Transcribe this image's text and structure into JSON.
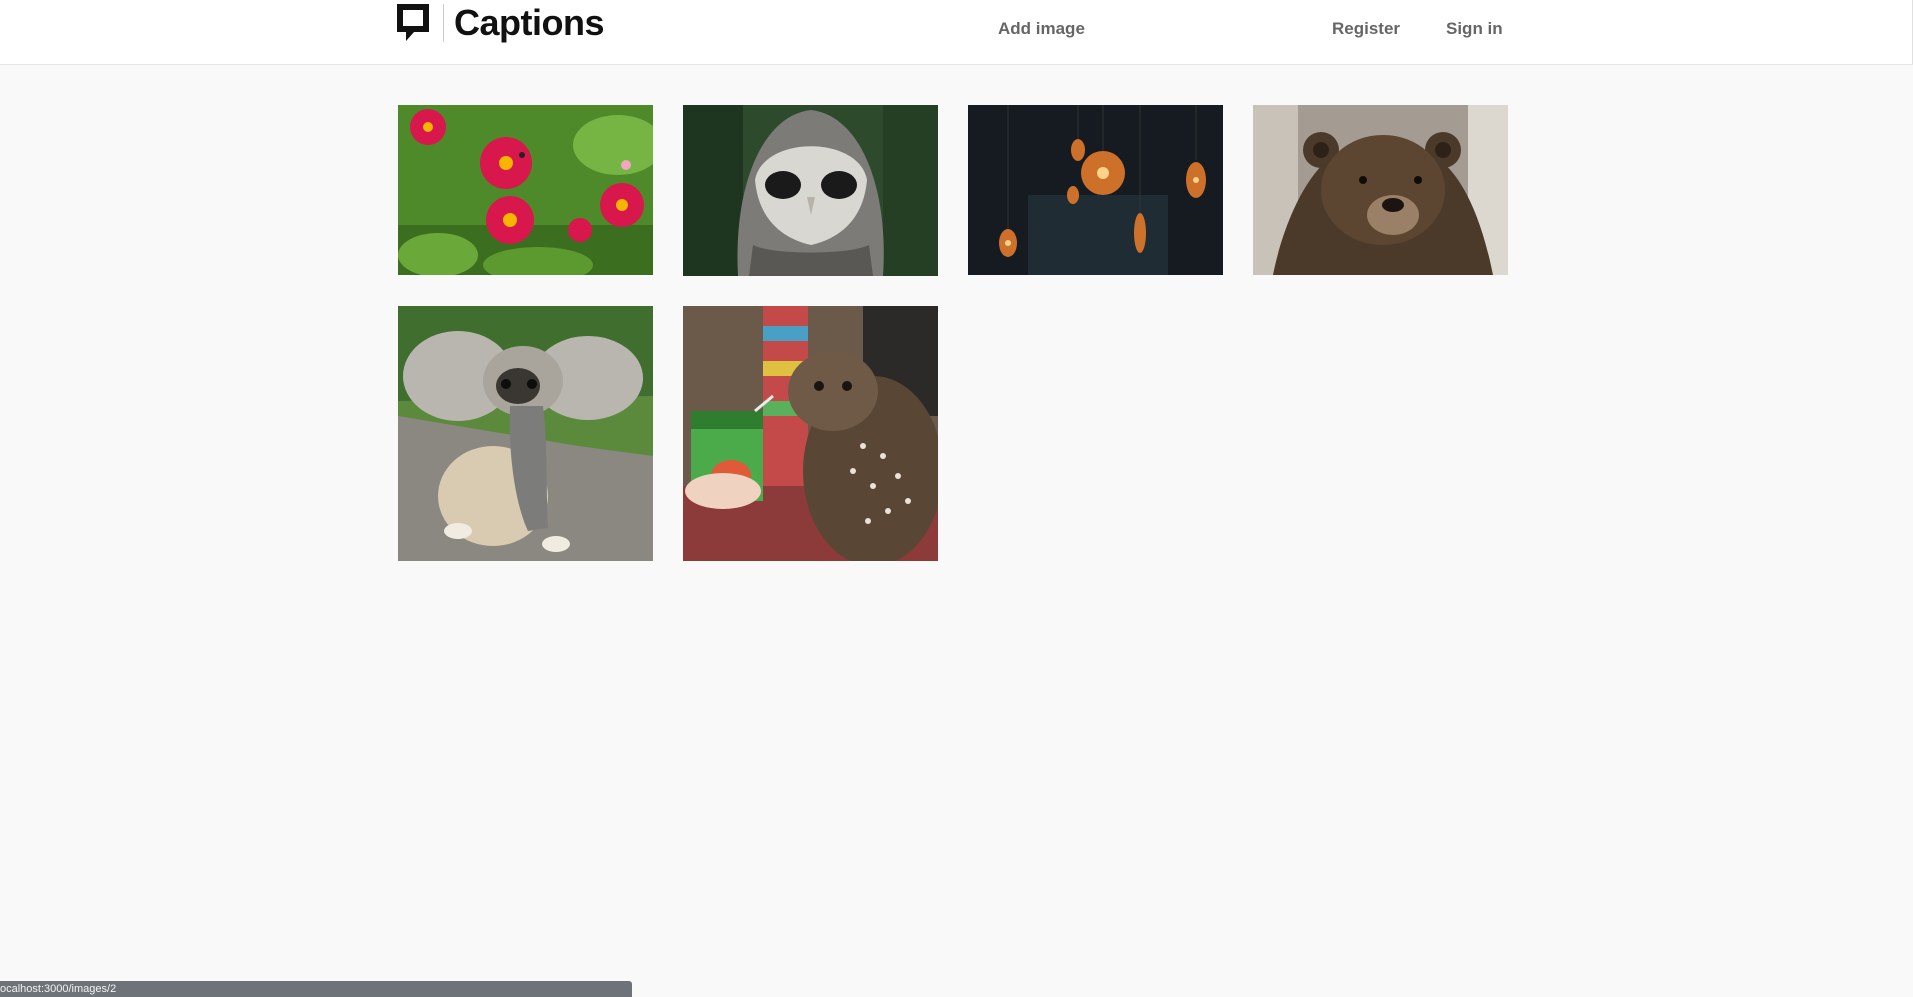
{
  "app": {
    "title": "Captions",
    "logo_icon": "speech-bubble-icon"
  },
  "nav": {
    "add_image": "Add image",
    "register": "Register",
    "sign_in": "Sign in"
  },
  "gallery": {
    "images": [
      {
        "subject": "pink-dahlia-flowers",
        "href": "/images/1"
      },
      {
        "subject": "barn-owl-face",
        "href": "/images/2"
      },
      {
        "subject": "hanging-edison-bulbs",
        "href": "/images/3"
      },
      {
        "subject": "brown-bear",
        "href": "/images/4"
      },
      {
        "subject": "pug-elephant-costume",
        "href": "/images/5"
      },
      {
        "subject": "owl-with-juice-box",
        "href": "/images/6"
      }
    ]
  },
  "status_bar": {
    "url": "ocalhost:3000/images/2"
  },
  "colors": {
    "background": "#f9f9f9",
    "header": "#ffffff",
    "nav_text": "#666666",
    "logo_text": "#111111",
    "status_bar": "#6e7279"
  }
}
